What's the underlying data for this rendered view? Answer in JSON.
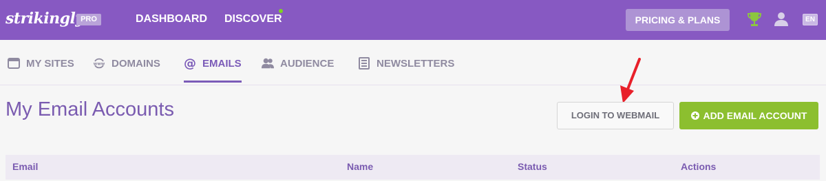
{
  "header": {
    "logo_text": "strikingly",
    "pro_badge": "PRO",
    "nav": {
      "dashboard": "DASHBOARD",
      "discover": "DISCOVER"
    },
    "pricing_button": "PRICING & PLANS",
    "language": "EN",
    "icons": [
      "trophy-icon",
      "user-icon"
    ],
    "colors": {
      "bar": "#8759c2",
      "notification_dot": "#7ed321"
    }
  },
  "subnav": {
    "tabs": [
      {
        "label": "MY SITES",
        "icon": "browser-window-icon",
        "active": false
      },
      {
        "label": "DOMAINS",
        "icon": "www-globe-icon",
        "active": false
      },
      {
        "label": "EMAILS",
        "icon": "at-sign-icon",
        "active": true
      },
      {
        "label": "AUDIENCE",
        "icon": "people-icon",
        "active": false
      },
      {
        "label": "NEWSLETTERS",
        "icon": "newsletter-icon",
        "active": false
      }
    ]
  },
  "main": {
    "title": "My Email Accounts",
    "login_webmail_button": "LOGIN TO WEBMAIL",
    "add_email_button": "ADD EMAIL ACCOUNT",
    "accent_green": "#8cbf2f",
    "annotation_arrow_color": "#e8202a"
  },
  "table": {
    "columns": [
      "Email",
      "Name",
      "Status",
      "Actions"
    ]
  }
}
